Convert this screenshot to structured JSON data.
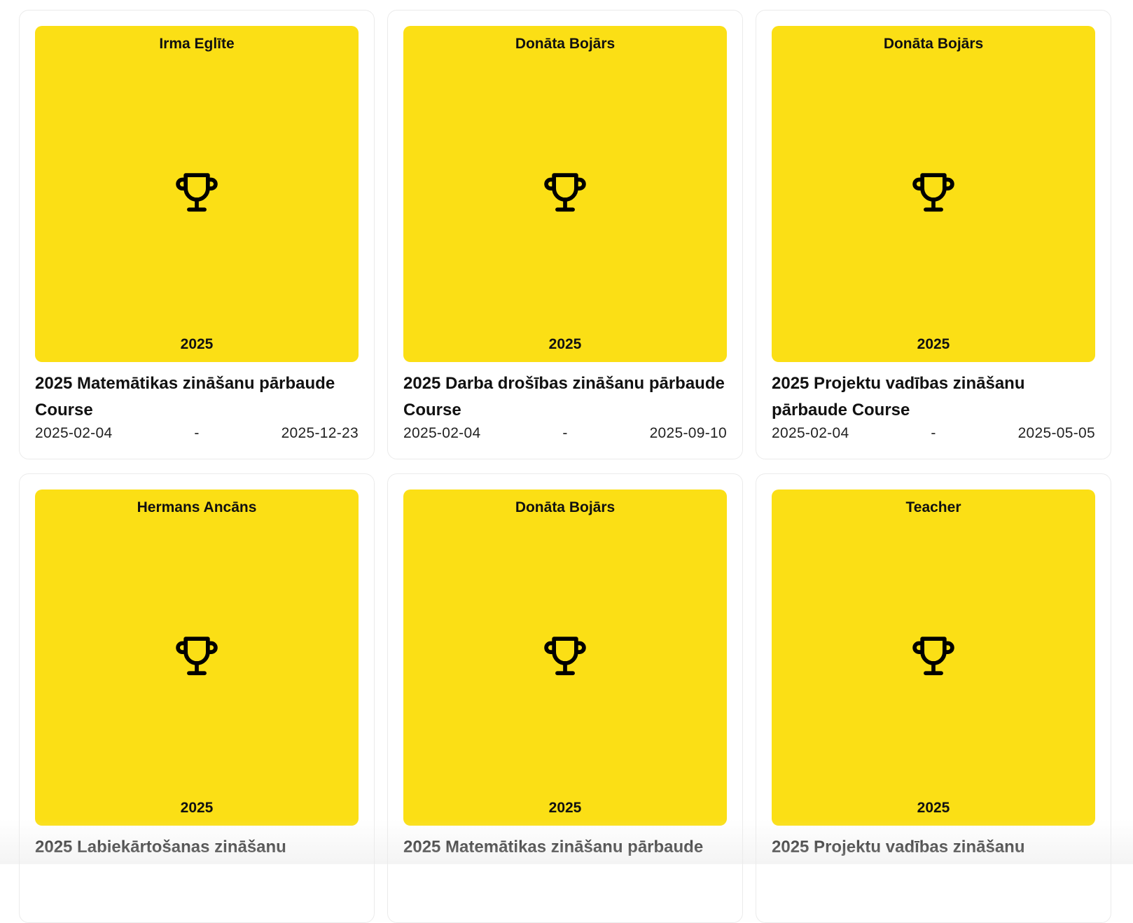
{
  "courses": [
    {
      "teacher": "Irma Eglīte",
      "year": "2025",
      "title": "2025 Matemātikas zināšanu pārbaude Course",
      "start": "2025-02-04",
      "sep": "-",
      "end": "2025-12-23"
    },
    {
      "teacher": "Donāta Bojārs",
      "year": "2025",
      "title": "2025 Darba drošības zināšanu pārbaude Course",
      "start": "2025-02-04",
      "sep": "-",
      "end": "2025-09-10"
    },
    {
      "teacher": "Donāta Bojārs",
      "year": "2025",
      "title": "2025 Projektu vadības zināšanu pārbaude Course",
      "start": "2025-02-04",
      "sep": "-",
      "end": "2025-05-05"
    },
    {
      "teacher": "Hermans Ancāns",
      "year": "2025",
      "title": "2025 Labiekārtošanas zināšanu"
    },
    {
      "teacher": "Donāta Bojārs",
      "year": "2025",
      "title": "2025 Matemātikas zināšanu pārbaude"
    },
    {
      "teacher": "Teacher",
      "year": "2025",
      "title": "2025 Projektu vadības zināšanu"
    }
  ],
  "icons": {
    "cover": "trophy-icon"
  },
  "colors": {
    "cover_bg": "#fbdf15",
    "card_border": "#ebebeb"
  }
}
